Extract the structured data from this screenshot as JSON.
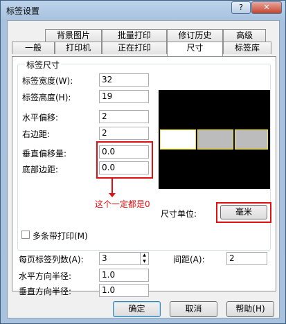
{
  "window": {
    "title": "标签设置",
    "help_label": "?",
    "close_label": "✕"
  },
  "tabs_row1": [
    "背景图片",
    "批量打印",
    "修订历史",
    "高级"
  ],
  "tabs_row2": [
    "一般",
    "打印机",
    "正在打印",
    "尺寸",
    "标签库"
  ],
  "group": {
    "title": "标签尺寸"
  },
  "fields": {
    "width": {
      "label": "标签宽度(W):",
      "value": "32"
    },
    "height": {
      "label": "标签高度(H):",
      "value": "19"
    },
    "hoffset": {
      "label": "水平偏移:",
      "value": "2"
    },
    "rmargin": {
      "label": "右边距:",
      "value": "2"
    },
    "voffset": {
      "label": "垂直偏移量:",
      "value": "0.0"
    },
    "bmargin": {
      "label": "底部边距:",
      "value": "0.0"
    }
  },
  "annotation": "这个一定都是0",
  "unit": {
    "label": "尺寸单位:",
    "button": "毫米"
  },
  "multi_strip": {
    "label": "多条带打印(M)",
    "checked": false
  },
  "per_page": {
    "label": "每页标签列数(A):",
    "value": "3",
    "spin_up": "▲",
    "spin_down": "▼"
  },
  "gap": {
    "label": "间距(A):",
    "value": "2"
  },
  "h_radius": {
    "label": "水平方向半径:",
    "value": "1.0"
  },
  "v_radius": {
    "label": "垂直方向半径:",
    "value": "1.0"
  },
  "buttons": {
    "ok": "确定",
    "cancel": "取消",
    "help": "帮助(H)"
  },
  "colors": {
    "annotation_red": "#e01010",
    "preview_bg": "#000000",
    "label_white": "#ffffff",
    "label_gray": "#bcbcbc",
    "label_edge": "#f5e500"
  }
}
